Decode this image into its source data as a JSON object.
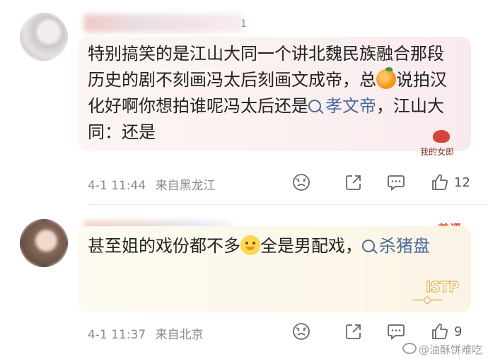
{
  "comments": [
    {
      "name_tail": "1",
      "segments": [
        "特别搞笑的是江山大同一个讲北魏民族融合那段历史的剧不刻画冯太后刻画文成帝，总",
        "说拍汉化好啊你想拍谁呢冯太后还是",
        "孝文帝",
        "，江山大同：还是"
      ],
      "emoji_name": "orange-emoji",
      "sticker_text": "我的女郎",
      "time": "4-1 11:44",
      "location": "来自黑龙江",
      "likes": "12"
    },
    {
      "badge": "首评",
      "segments": [
        "甚至姐的戏份都不多",
        "全是男配戏，",
        "杀猪盘"
      ],
      "emoji_name": "duck-emoji",
      "sticker_text": "ISTP",
      "time": "4-1 11:37",
      "location": "来自北京",
      "likes": "9"
    }
  ],
  "icons": [
    "dislike-icon",
    "share-icon",
    "comment-icon",
    "like-icon"
  ],
  "watermark": "@油酥饼难吃",
  "colors": {
    "topic": "#4a6a9c",
    "badge": "#e8532f",
    "meta": "#8a8a8a"
  }
}
